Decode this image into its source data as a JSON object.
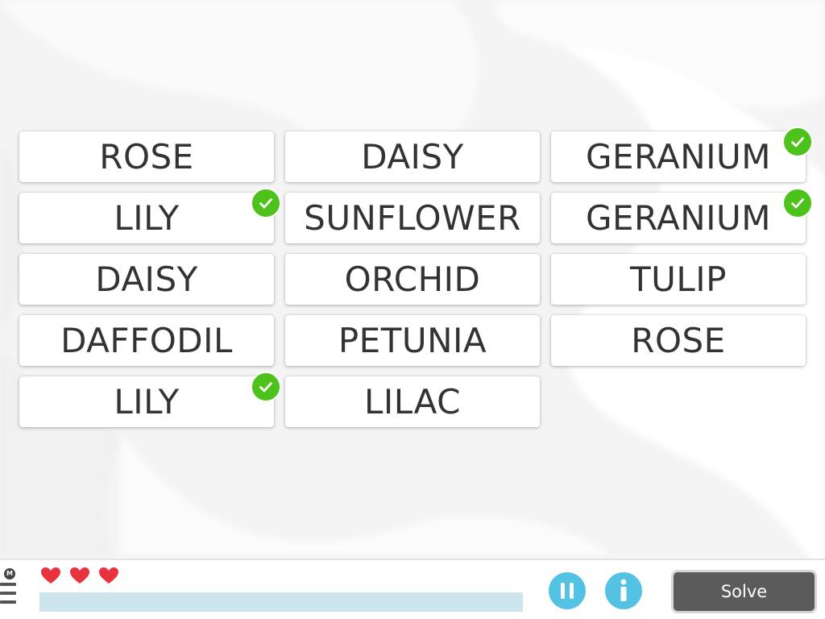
{
  "board": {
    "cards": [
      {
        "label": "ROSE",
        "matched": false
      },
      {
        "label": "DAISY",
        "matched": false
      },
      {
        "label": "GERANIUM",
        "matched": true
      },
      {
        "label": "LILY",
        "matched": true
      },
      {
        "label": "SUNFLOWER",
        "matched": false
      },
      {
        "label": "GERANIUM",
        "matched": true
      },
      {
        "label": "DAISY",
        "matched": false
      },
      {
        "label": "ORCHID",
        "matched": false
      },
      {
        "label": "TULIP",
        "matched": false
      },
      {
        "label": "DAFFODIL",
        "matched": false
      },
      {
        "label": "PETUNIA",
        "matched": false
      },
      {
        "label": "ROSE",
        "matched": false
      },
      {
        "label": "LILY",
        "matched": true
      },
      {
        "label": "LILAC",
        "matched": false
      }
    ]
  },
  "bottom_bar": {
    "menu_badge": "M",
    "lives": 3,
    "progress": 0,
    "pause_icon": "pause-icon",
    "info_icon": "info-icon",
    "solve_label": "Solve"
  },
  "colors": {
    "check": "#4cc21a",
    "heart": "#e8333f",
    "round_button": "#54c3e3",
    "solve_button": "#5b5b5b",
    "progress_track": "#cde6ee"
  }
}
